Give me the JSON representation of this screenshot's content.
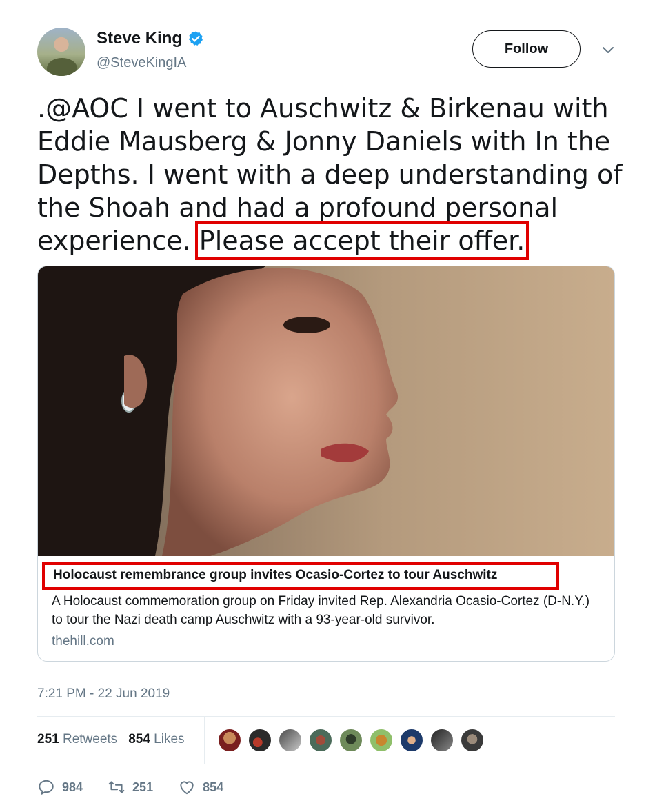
{
  "author": {
    "name": "Steve King",
    "handle": "@SteveKingIA",
    "verified": true
  },
  "follow_label": "Follow",
  "tweet": {
    "text_main": ".@AOC I went to Auschwitz & Birkenau with Eddie Mausberg & Jonny Daniels with In the Depths. I went with a deep understanding of the Shoah and had a profound personal experience.",
    "text_highlight": "Please accept their offer."
  },
  "card": {
    "title": "Holocaust remembrance group invites Ocasio-Cortez to tour Auschwitz",
    "description": "A Holocaust commemoration group on Friday invited Rep. Alexandria Ocasio-Cortez (D-N.Y.) to tour the Nazi death camp Auschwitz with a 93-year-old survivor.",
    "domain": "thehill.com"
  },
  "timestamp": "7:21 PM - 22 Jun 2019",
  "stats": {
    "retweets_count": "251",
    "retweets_label": "Retweets",
    "likes_count": "854",
    "likes_label": "Likes"
  },
  "actions": {
    "reply_count": "984",
    "retweet_count": "251",
    "like_count": "854"
  },
  "colors": {
    "highlight_box": "#e00000",
    "verified_blue": "#1da1f2",
    "muted": "#657786"
  },
  "icons": [
    "verified-badge-icon",
    "chevron-down-icon",
    "reply-icon",
    "retweet-icon",
    "like-icon"
  ]
}
